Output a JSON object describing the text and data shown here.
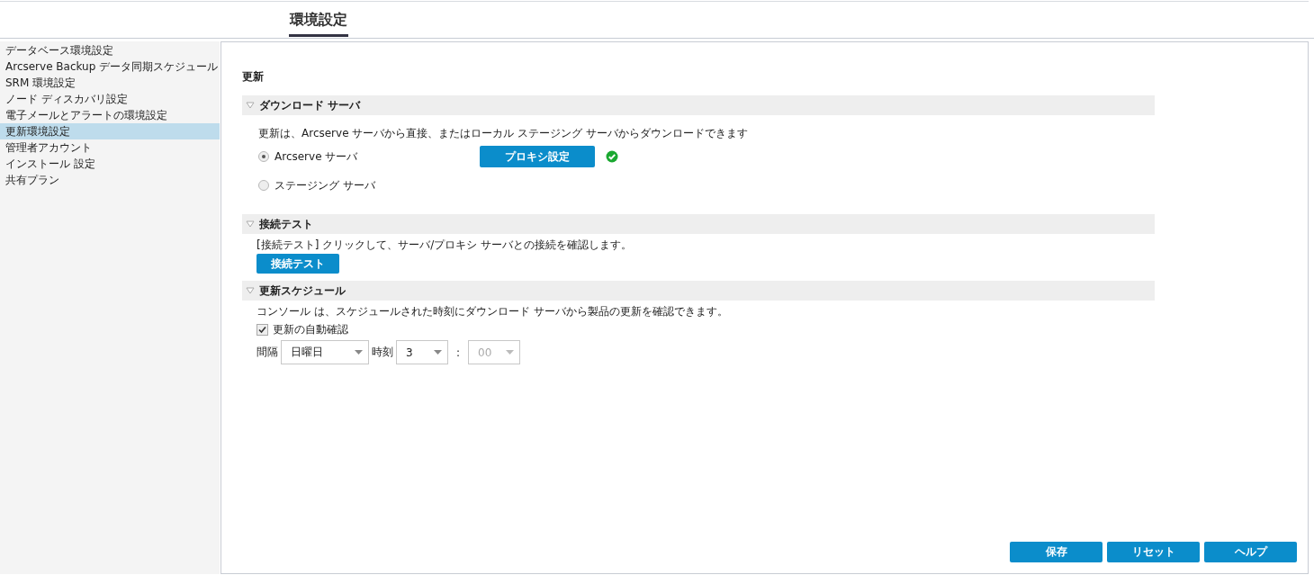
{
  "header": {
    "title": "環境設定"
  },
  "sidebar": {
    "items": [
      {
        "label": "データベース環境設定",
        "selected": false
      },
      {
        "label": "Arcserve Backup データ同期スケジュール",
        "selected": false
      },
      {
        "label": "SRM 環境設定",
        "selected": false
      },
      {
        "label": "ノード ディスカバリ設定",
        "selected": false
      },
      {
        "label": "電子メールとアラートの環境設定",
        "selected": false
      },
      {
        "label": "更新環境設定",
        "selected": true
      },
      {
        "label": "管理者アカウント",
        "selected": false
      },
      {
        "label": "インストール 設定",
        "selected": false
      },
      {
        "label": "共有プラン",
        "selected": false
      }
    ]
  },
  "panel": {
    "title": "更新",
    "download_server": {
      "heading": "ダウンロード サーバ",
      "expanded": true,
      "description": "更新は、Arcserve サーバから直接、またはローカル ステージング サーバからダウンロードできます",
      "options": [
        {
          "label": "Arcserve サーバ",
          "selected": true
        },
        {
          "label": "ステージング サーバ",
          "selected": false
        }
      ],
      "proxy_button": "プロキシ設定",
      "proxy_ok": true
    },
    "connection_test": {
      "heading": "接続テスト",
      "expanded": true,
      "description": "[接続テスト] クリックして、サーバ/プロキシ サーバとの接続を確認します。",
      "button": "接続テスト"
    },
    "schedule": {
      "heading": "更新スケジュール",
      "expanded": true,
      "description": "コンソール は、スケジュールされた時刻にダウンロード サーバから製品の更新を確認できます。",
      "auto_check": {
        "label": "更新の自動確認",
        "checked": true
      },
      "interval_label": "間隔",
      "interval": {
        "value": "日曜日",
        "disabled": false
      },
      "time_label": "時刻",
      "hour": {
        "value": "3",
        "disabled": false
      },
      "separator": ":",
      "minute": {
        "value": "00",
        "disabled": true
      }
    }
  },
  "buttons": [
    "保存",
    "リセット",
    "ヘルプ"
  ]
}
